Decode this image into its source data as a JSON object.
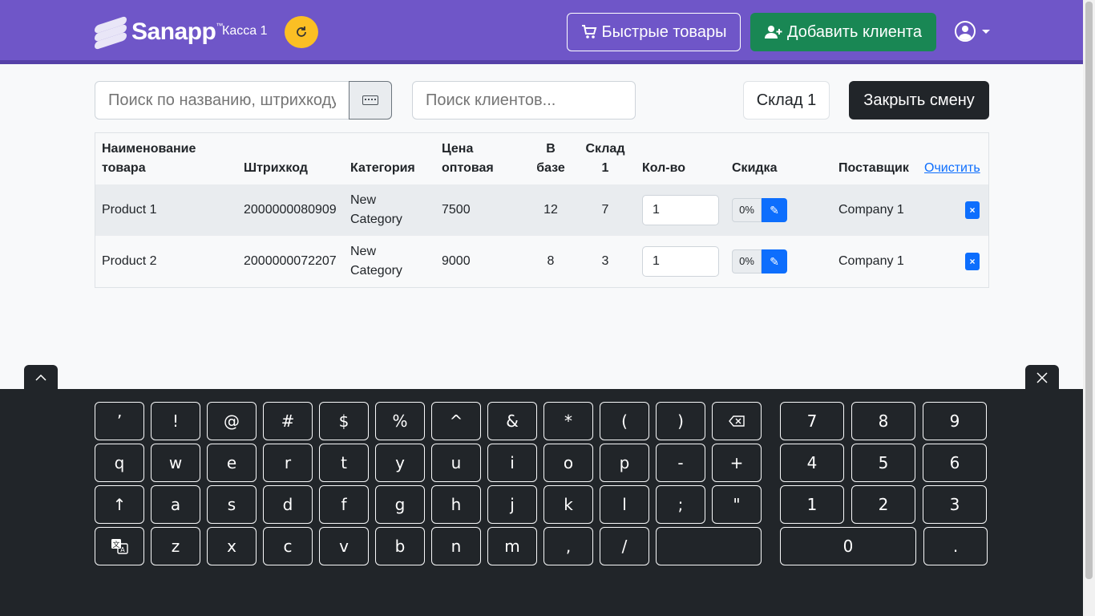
{
  "header": {
    "logo_text": "Sanapp",
    "logo_tm": "™",
    "register": "Касса 1",
    "quick_goods": "Быстрые товары",
    "add_client": "Добавить клиента"
  },
  "search": {
    "product_placeholder": "Поиск по названию, штрихкоду",
    "client_placeholder": "Поиск клиентов..."
  },
  "toolbar": {
    "warehouse": "Склад 1",
    "close_shift": "Закрыть смену"
  },
  "table": {
    "headers": {
      "name": "Наименование товара",
      "barcode": "Штрихкод",
      "category": "Категория",
      "price": "Цена оптовая",
      "in_base": "В базе",
      "warehouse": "Склад 1",
      "qty": "Кол-во",
      "discount": "Скидка",
      "supplier": "Поставщик",
      "clear": "Очистить"
    },
    "rows": [
      {
        "name": "Product 1",
        "barcode": "2000000080909",
        "category": "New Category",
        "price": "7500",
        "in_base": "12",
        "warehouse": "7",
        "qty": "1",
        "discount": "0%",
        "supplier": "Company 1"
      },
      {
        "name": "Product 2",
        "barcode": "2000000072207",
        "category": "New Category",
        "price": "9000",
        "in_base": "8",
        "warehouse": "3",
        "qty": "1",
        "discount": "0%",
        "supplier": "Company 1"
      }
    ]
  },
  "keyboard": {
    "rows": [
      [
        "’",
        "!",
        "@",
        "#",
        "$",
        "%",
        "^",
        "&",
        "*",
        "(",
        ")",
        "⌫"
      ],
      [
        "q",
        "w",
        "e",
        "r",
        "t",
        "y",
        "u",
        "i",
        "o",
        "p",
        "-",
        "+"
      ],
      [
        "↑",
        "a",
        "s",
        "d",
        "f",
        "g",
        "h",
        "j",
        "k",
        "l",
        ";",
        "\""
      ],
      [
        "文A",
        "z",
        "x",
        "c",
        "v",
        "b",
        "n",
        "m",
        ",",
        "/",
        " "
      ]
    ],
    "numpad": [
      [
        "7",
        "8",
        "9"
      ],
      [
        "4",
        "5",
        "6"
      ],
      [
        "1",
        "2",
        "3"
      ],
      [
        "0",
        "."
      ]
    ]
  },
  "colors": {
    "navbar": "#6f56c8",
    "success": "#198754",
    "primary": "#0d6efd",
    "dark": "#212529",
    "warning": "#fbbf24"
  }
}
